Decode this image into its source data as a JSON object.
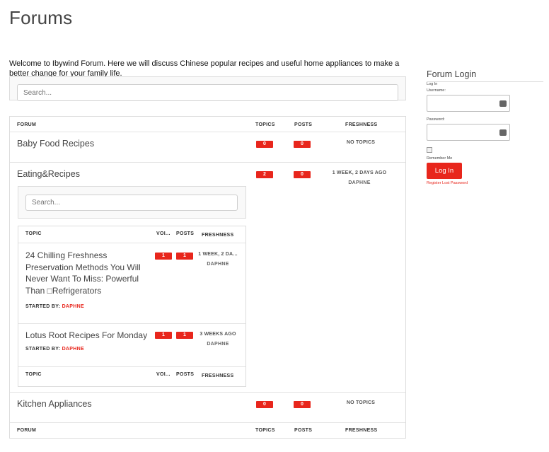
{
  "page": {
    "title": "Forums",
    "welcome": "Welcome to Ibywind Forum. Here we will discuss Chinese popular recipes and useful home appliances to make a better change for your family life."
  },
  "search": {
    "placeholder": "Search..."
  },
  "forum_table": {
    "headers": {
      "forum": "FORUM",
      "topics": "TOPICS",
      "posts": "POSTS",
      "freshness": "FRESHNESS"
    },
    "forums": [
      {
        "name": "Baby Food Recipes",
        "topics": "0",
        "posts": "0",
        "freshness": "NO TOPICS"
      },
      {
        "name": "Eating&Recipes",
        "topics": "2",
        "posts": "0",
        "freshness": "1 WEEK, 2 DAYS AGO",
        "author": "DAPHNE"
      },
      {
        "name": "Kitchen Appliances",
        "topics": "0",
        "posts": "0",
        "freshness": "NO TOPICS"
      }
    ]
  },
  "topic_table": {
    "search_placeholder": "Search...",
    "headers": {
      "topic": "TOPIC",
      "voices": "VOI...",
      "posts": "POSTS",
      "freshness": "FRESHNESS"
    },
    "topics": [
      {
        "title": "24 Chilling Freshness Preservation Methods You Will Never Want To Miss: Powerful Than □Refrigerators",
        "started_by_label": "STARTED BY:",
        "started_by": "DAPHNE",
        "voices": "1",
        "posts": "1",
        "freshness": "1 WEEK, 2 DA...",
        "author": "DAPHNE"
      },
      {
        "title": "Lotus Root Recipes For Monday",
        "started_by_label": "STARTED BY:",
        "started_by": "DAPHNE",
        "voices": "1",
        "posts": "1",
        "freshness": "3 WEEKS AGO",
        "author": "DAPHNE"
      }
    ]
  },
  "login": {
    "title": "Forum Login",
    "subtitle": "Log In",
    "username_label": "Username:",
    "password_label": "Password:",
    "remember_label": "Remember Me",
    "button": "Log In",
    "links": "Register Lost Password"
  },
  "colors": {
    "accent": "#e8261c",
    "border": "#dcdcdc",
    "panel": "#f9f9f9"
  }
}
